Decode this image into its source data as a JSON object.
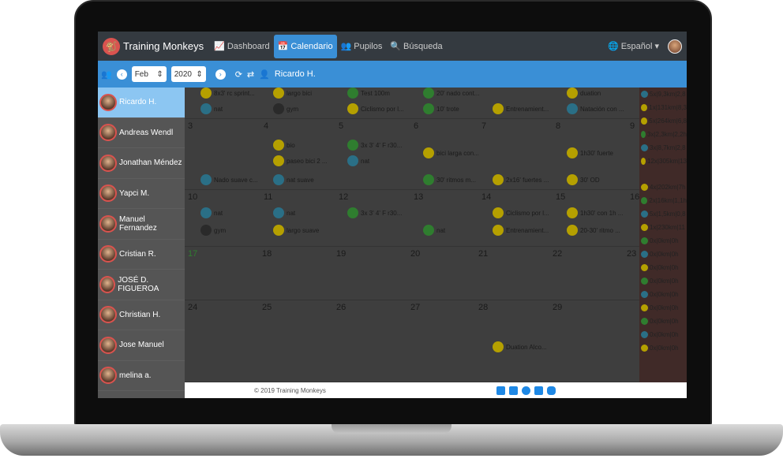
{
  "brand": {
    "name": "Training Monkeys"
  },
  "nav": {
    "dashboard": "Dashboard",
    "calendario": "Calendario",
    "pupilos": "Pupilos",
    "busqueda": "Búsqueda",
    "language": "Español"
  },
  "toolbar": {
    "month": "Feb",
    "year": "2020",
    "athlete": "Ricardo H."
  },
  "athletes": [
    "Ricardo H.",
    "Andreas Wendl",
    "Jonathan Méndez",
    "Yapci M.",
    "Manuel Fernandez",
    "Cristian R.",
    "JOSÉ D. FIGUEROA",
    "Christian H.",
    "Jose Manuel",
    "melina a."
  ],
  "week0": {
    "ev1": "8x3' rc sprint...",
    "ev2": "largo bici",
    "ev3": "Test 100m",
    "ev4": "20' nado cont...",
    "ev5": "duation",
    "ev6": "nat",
    "ev7": "gym",
    "ev8": "Ciclismo por l...",
    "ev9": "10' trote",
    "ev10": "Entrenamient...",
    "ev11": "Natación con ..."
  },
  "week1": {
    "days": [
      "3",
      "4",
      "5",
      "6",
      "7",
      "8",
      "9"
    ],
    "ev1": "bio",
    "ev2": "3x 3' 4' F r30...",
    "ev3": "paseo bici 2 ...",
    "ev4": "nat",
    "ev5": "bici larga con...",
    "ev6": "1h30' fuerte",
    "ev7": "Nado suave c...",
    "ev8": "nat suave",
    "ev9": "30' ritmos m...",
    "ev10": "2x16' fuertes ...",
    "ev11": "30' OD"
  },
  "week2": {
    "days": [
      "10",
      "11",
      "12",
      "13",
      "14",
      "15",
      "16"
    ],
    "ev1": "nat",
    "ev2": "nat",
    "ev3": "3x 3' 4' F r30...",
    "ev4": "Ciclismo por l...",
    "ev5": "1h30' con 1h ...",
    "ev6": "gym",
    "ev7": "largo suave",
    "ev8": "nat",
    "ev9": "Entrenamient...",
    "ev10": "20-30' ritmo ..."
  },
  "week3": {
    "days": [
      "17",
      "18",
      "19",
      "20",
      "21",
      "22",
      "23"
    ]
  },
  "week4": {
    "days": [
      "24",
      "25",
      "26",
      "27",
      "28",
      "29"
    ],
    "ev1": "Duation Alco..."
  },
  "summary": [
    "5x|9,3km|2,8",
    "1x|131km|8,3",
    "5x|264km|6,8",
    "3x|2,3km|2,2h",
    "3x|8,7km|2,8",
    "12x|305km|13",
    "4x|202km|7h",
    "2x|16km|1,1h",
    "5x|1,5km|0,8",
    "1x|230km|11",
    "0x|0km|0h",
    "0x|0km|0h",
    "0x|0km|0h",
    "0x|0km|0h",
    "0x|0km|0h",
    "0x|0km|0h",
    "0x|0km|0h",
    "0x|0km|0h",
    "0x|0km|0h"
  ],
  "footer": {
    "copyright": "© 2019 Training Monkeys"
  }
}
